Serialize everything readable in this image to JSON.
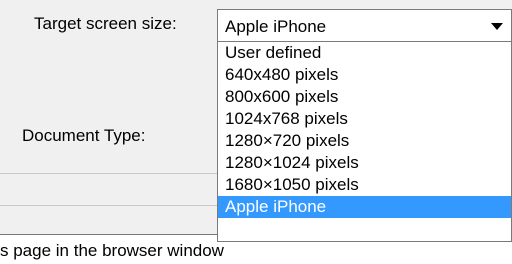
{
  "form": {
    "target_label": "Target screen size:",
    "doc_type_label": "Document Type:"
  },
  "screen_size_select": {
    "selected": "Apple iPhone",
    "options": [
      "User defined",
      "640x480 pixels",
      "800x600 pixels",
      "1024x768 pixels",
      "1280×720 pixels",
      "1280×1024 pixels",
      "1680×1050 pixels",
      "Apple iPhone"
    ],
    "highlighted_index": 7
  },
  "window_option": {
    "value": "s page in the browser window"
  },
  "colors": {
    "selection": "#3399ff",
    "border": "#7a7a7a",
    "panel": "#f0f0f0"
  }
}
